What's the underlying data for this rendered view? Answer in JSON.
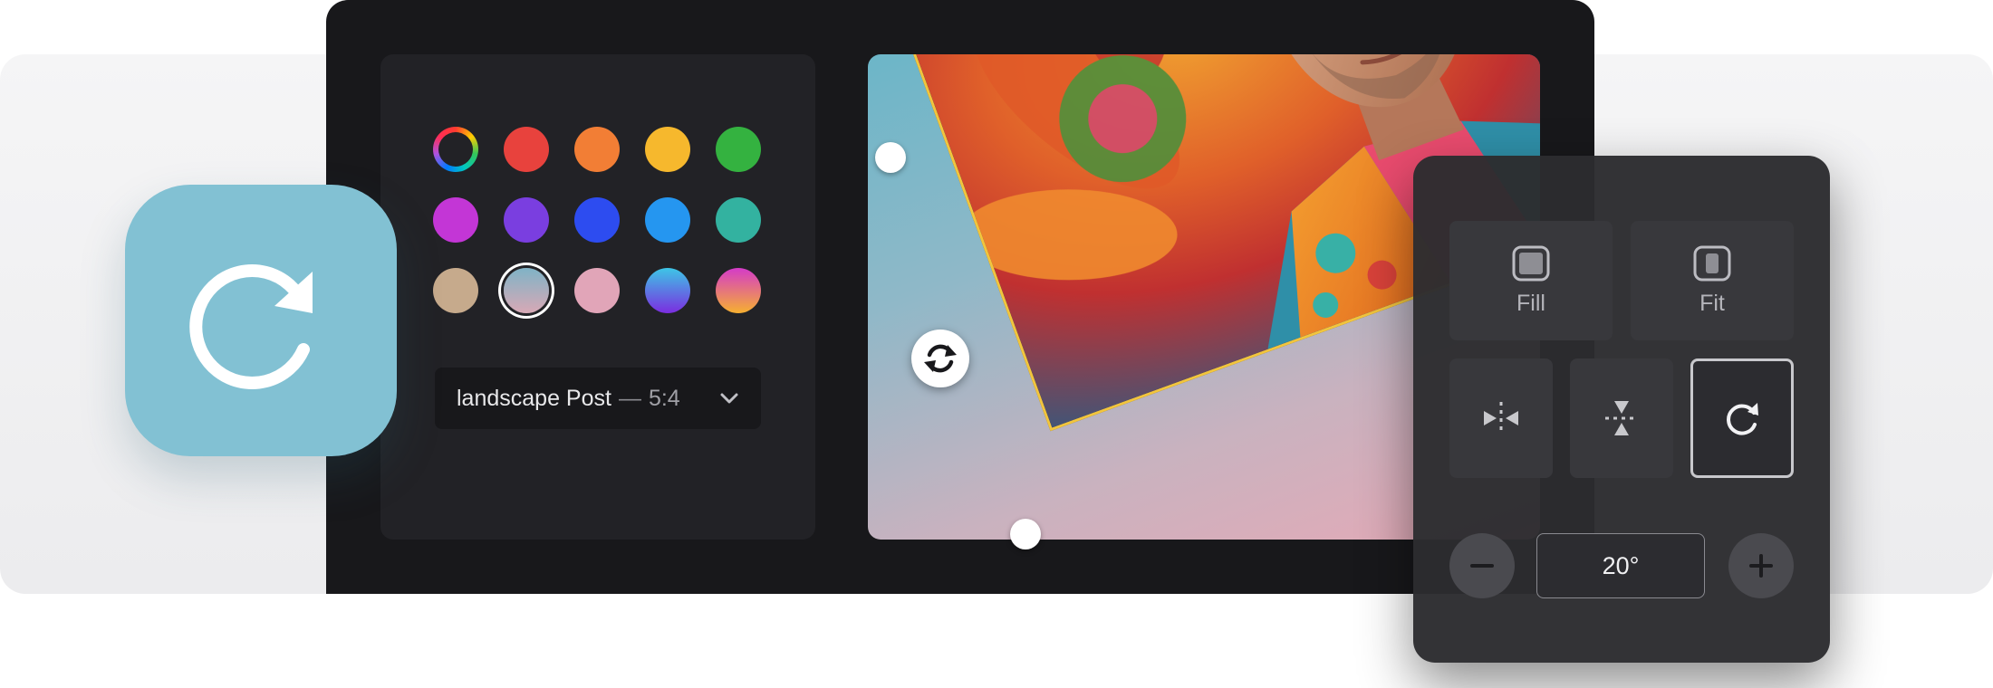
{
  "colors": {
    "app_tile": "#82c1d3",
    "crop_border": "#f2c53d",
    "editor_bg": "#18181b",
    "panel_bg": "#222226"
  },
  "palette": [
    {
      "name": "custom-picker",
      "color": "conic-rainbow"
    },
    {
      "name": "red",
      "color": "#e8423d"
    },
    {
      "name": "orange",
      "color": "#f27e35"
    },
    {
      "name": "yellow",
      "color": "#f6b82d"
    },
    {
      "name": "green",
      "color": "#34b240"
    },
    {
      "name": "magenta",
      "color": "#c336d6"
    },
    {
      "name": "violet",
      "color": "#7a3ee0"
    },
    {
      "name": "blue",
      "color": "#2d4cf0"
    },
    {
      "name": "sky",
      "color": "#2596f0"
    },
    {
      "name": "teal",
      "color": "#33b2a0"
    },
    {
      "name": "sand",
      "color": "#c6aa8c"
    },
    {
      "name": "blue-pink-gradient",
      "color": "linear-gradient(180deg,#7fb3c6,#d8a9b6)",
      "selected": true
    },
    {
      "name": "pink",
      "color": "#e1a5b8"
    },
    {
      "name": "blue-violet-gradient",
      "color": "linear-gradient(180deg,#3dc6e6,#7b2de0)"
    },
    {
      "name": "pink-orange-gradient",
      "color": "linear-gradient(180deg,#d43bc9,#f6b030)"
    }
  ],
  "format": {
    "name": "landscape Post",
    "separator": "—",
    "ratio": "5:4"
  },
  "tools": {
    "fill_label": "Fill",
    "fit_label": "Fit",
    "angle_value": "20°"
  },
  "icons": {
    "app": "rotate-clockwise-icon",
    "rotate_handle": "rotate-sync-icon",
    "flip_horizontal": "flip-horizontal-icon",
    "flip_vertical": "flip-vertical-icon",
    "rotate": "rotate-clockwise-icon",
    "minus": "minus-icon",
    "plus": "plus-icon",
    "chevron": "chevron-down-icon"
  }
}
